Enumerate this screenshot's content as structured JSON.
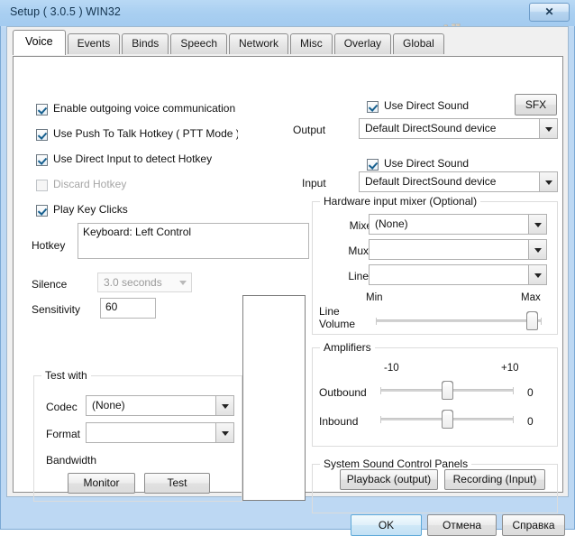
{
  "window": {
    "title": "Setup ( 3.0.5 ) WIN32",
    "close_label": "✕",
    "watermark": "Allmmorpg.ru"
  },
  "tabs": [
    {
      "label": "Voice",
      "active": true
    },
    {
      "label": "Events",
      "active": false
    },
    {
      "label": "Binds",
      "active": false
    },
    {
      "label": "Speech",
      "active": false
    },
    {
      "label": "Network",
      "active": false
    },
    {
      "label": "Misc",
      "active": false
    },
    {
      "label": "Overlay",
      "active": false
    },
    {
      "label": "Global",
      "active": false
    }
  ],
  "voice": {
    "checkboxes": [
      {
        "label": "Enable outgoing voice communication",
        "checked": true,
        "disabled": false
      },
      {
        "label": "Use Push To Talk Hotkey ( PTT Mode )",
        "checked": true,
        "disabled": false
      },
      {
        "label": "Use Direct Input to detect Hotkey",
        "checked": true,
        "disabled": false
      },
      {
        "label": "Discard Hotkey",
        "checked": false,
        "disabled": true
      },
      {
        "label": "Play Key Clicks",
        "checked": true,
        "disabled": false
      }
    ],
    "hotkey_label": "Hotkey",
    "hotkey_value": "Keyboard: Left Control",
    "silence_label": "Silence",
    "silence_value": "3.0 seconds",
    "sensitivity_label": "Sensitivity",
    "sensitivity_value": "60"
  },
  "test_with": {
    "title": "Test with",
    "codec_label": "Codec",
    "codec_value": "(None)",
    "format_label": "Format",
    "format_value": "",
    "bandwidth_label": "Bandwidth",
    "monitor_button": "Monitor",
    "test_button": "Test"
  },
  "output": {
    "label": "Output",
    "direct_sound_label": "Use Direct Sound",
    "direct_sound_checked": true,
    "device_value": "Default DirectSound device",
    "sfx_button": "SFX"
  },
  "input": {
    "label": "Input",
    "direct_sound_label": "Use Direct Sound",
    "direct_sound_checked": true,
    "device_value": "Default DirectSound device"
  },
  "mixer": {
    "title": "Hardware input mixer (Optional)",
    "mixer_label": "Mixer",
    "mixer_value": "(None)",
    "mux_label": "Mux",
    "mux_value": "",
    "line_label": "Line",
    "line_value": "",
    "min_label": "Min",
    "max_label": "Max",
    "volume_label_1": "Line",
    "volume_label_2": "Volume",
    "volume_percent": 94
  },
  "amplifiers": {
    "title": "Amplifiers",
    "min_label": "-10",
    "max_label": "+10",
    "outbound_label": "Outbound",
    "outbound_value": "0",
    "outbound_percent": 50,
    "inbound_label": "Inbound",
    "inbound_value": "0",
    "inbound_percent": 50
  },
  "sound_panels": {
    "title": "System Sound Control Panels",
    "playback_button": "Playback (output)",
    "recording_button": "Recording (Input)"
  },
  "footer": {
    "ok_button": "OK",
    "cancel_button": "Отмена",
    "help_button": "Справка"
  }
}
